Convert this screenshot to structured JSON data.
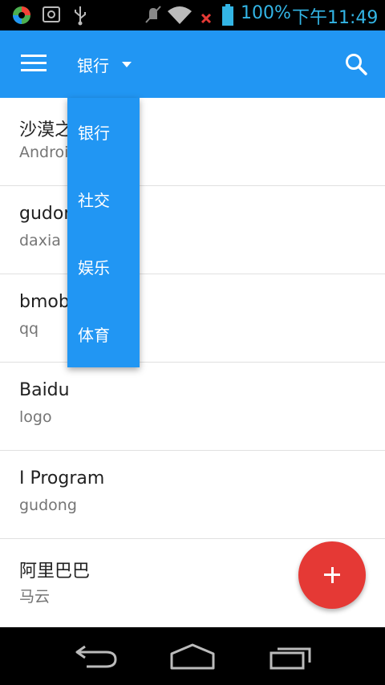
{
  "status_bar": {
    "battery_percent_text": "100%",
    "time": "下午11:49",
    "icons": [
      "app-icon",
      "screenshot-icon",
      "usb-icon",
      "mute-icon",
      "wifi-icon",
      "signal-off-icon",
      "battery-icon"
    ],
    "accent_color": "#33b5e5"
  },
  "toolbar": {
    "spinner_selected": "银行",
    "color": "#2196f3"
  },
  "dropdown": {
    "items": [
      "银行",
      "社交",
      "娱乐",
      "体育"
    ]
  },
  "list": {
    "items": [
      {
        "title": "沙漠之",
        "subtitle": "Androi"
      },
      {
        "title": "gudon",
        "subtitle": "daxia"
      },
      {
        "title": "bmob",
        "subtitle": "qq"
      },
      {
        "title": "Baidu",
        "subtitle": "logo"
      },
      {
        "title": "I Program",
        "subtitle": "gudong"
      },
      {
        "title": "阿里巴巴",
        "subtitle": "马云"
      }
    ]
  },
  "fab": {
    "icon": "plus-icon",
    "color": "#e53935"
  },
  "nav_bar": {
    "buttons": [
      "back-icon",
      "home-icon",
      "recents-icon"
    ]
  }
}
